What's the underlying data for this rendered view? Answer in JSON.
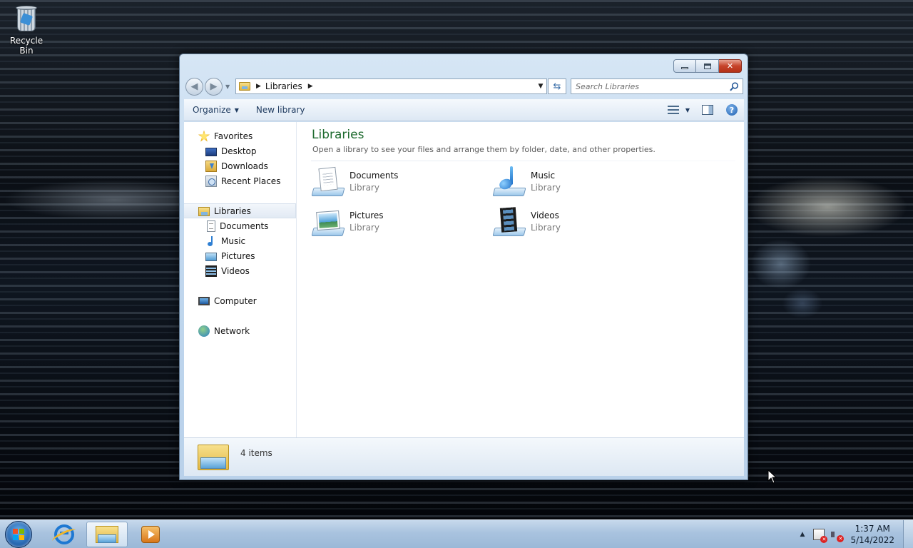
{
  "desktop": {
    "recycle_bin_label": "Recycle Bin"
  },
  "window": {
    "address": {
      "location": "Libraries"
    },
    "search": {
      "placeholder": "Search Libraries"
    },
    "commands": {
      "organize": "Organize",
      "new_library": "New library"
    },
    "nav": {
      "favorites": "Favorites",
      "desktop": "Desktop",
      "downloads": "Downloads",
      "recent_places": "Recent Places",
      "libraries": "Libraries",
      "documents": "Documents",
      "music": "Music",
      "pictures": "Pictures",
      "videos": "Videos",
      "computer": "Computer",
      "network": "Network"
    },
    "main": {
      "title": "Libraries",
      "subtitle": "Open a library to see your files and arrange them by folder, date, and other properties.",
      "items": [
        {
          "name": "Documents",
          "type": "Library",
          "icon": "documents-library-icon"
        },
        {
          "name": "Music",
          "type": "Library",
          "icon": "music-library-icon"
        },
        {
          "name": "Pictures",
          "type": "Library",
          "icon": "pictures-library-icon"
        },
        {
          "name": "Videos",
          "type": "Library",
          "icon": "videos-library-icon"
        }
      ]
    },
    "details": {
      "count_text": "4 items"
    }
  },
  "taskbar": {
    "clock_time": "1:37 AM",
    "clock_date": "5/14/2022"
  },
  "colors": {
    "title_green": "#1e6b2f",
    "taskbar": "#a9c3df",
    "close_red": "#c6432a"
  }
}
